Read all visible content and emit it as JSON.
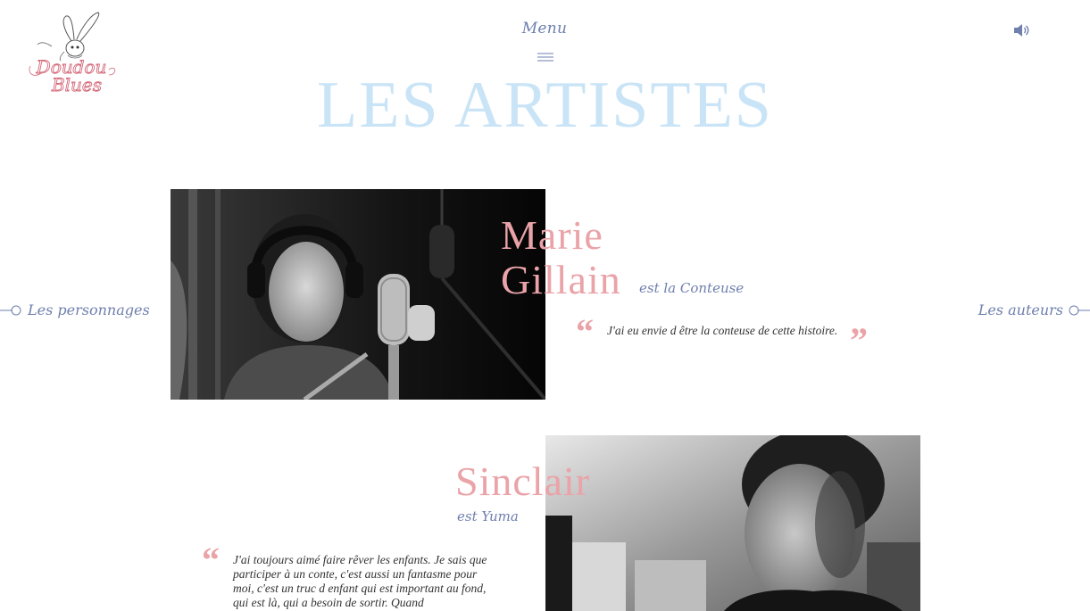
{
  "logo": {
    "text_line1": "Doudou",
    "text_line2": "Blues"
  },
  "header": {
    "menu_label": "Menu",
    "menu_icon": "hamburger-icon",
    "sound_icon": "speaker-icon"
  },
  "page": {
    "title": "LES ARTISTES"
  },
  "nav": {
    "prev_label": "Les personnages",
    "next_label": "Les auteurs"
  },
  "artists": [
    {
      "name_line1": "Marie",
      "name_line2": "Gillain",
      "role": "est la Conteuse",
      "quote": "J'ai eu envie d être la conteuse de cette histoire."
    },
    {
      "name_line1": "Sinclair",
      "role": "est Yuma",
      "quote": "J'ai toujours aimé faire rêver les enfants. Je sais que participer à un conte, c'est aussi un fantasme pour moi, c'est un truc d enfant qui est important au fond, qui est là, qui a besoin de sortir. Quand"
    }
  ],
  "colors": {
    "title": "#c9e4f6",
    "name": "#eaa3a8",
    "accent": "#6f7fae"
  }
}
